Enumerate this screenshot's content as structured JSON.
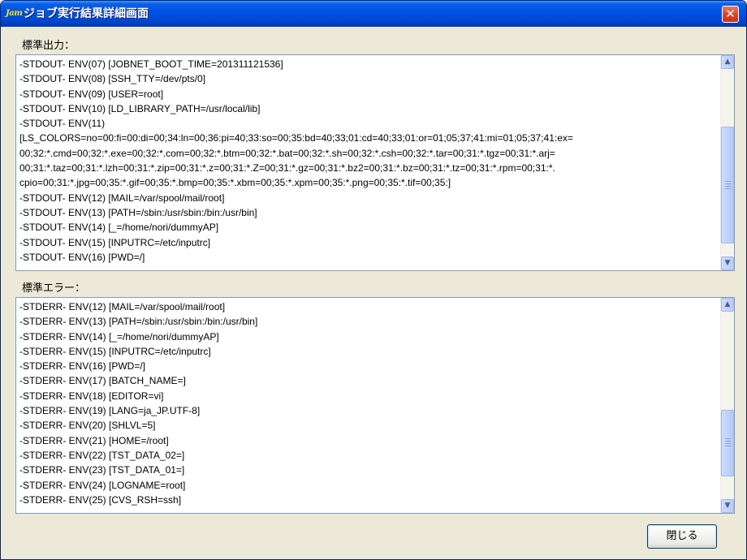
{
  "window": {
    "app_icon_text": "Jam",
    "title": "ジョブ実行結果詳細画面",
    "close_glyph": "✕"
  },
  "stdout": {
    "label": "標準出力：",
    "lines": [
      "-STDOUT- ENV(07) [JOBNET_BOOT_TIME=201311121536]",
      "-STDOUT- ENV(08) [SSH_TTY=/dev/pts/0]",
      "-STDOUT- ENV(09) [USER=root]",
      "-STDOUT- ENV(10) [LD_LIBRARY_PATH=/usr/local/lib]",
      "-STDOUT- ENV(11)",
      "[LS_COLORS=no=00:fi=00:di=00;34:ln=00;36:pi=40;33:so=00;35:bd=40;33;01:cd=40;33;01:or=01;05;37;41:mi=01;05;37;41:ex=",
      "00;32:*.cmd=00;32:*.exe=00;32:*.com=00;32:*.btm=00;32:*.bat=00;32:*.sh=00;32:*.csh=00;32:*.tar=00;31:*.tgz=00;31:*.arj=",
      "00;31:*.taz=00;31:*.lzh=00;31:*.zip=00;31:*.z=00;31:*.Z=00;31:*.gz=00;31:*.bz2=00;31:*.bz=00;31:*.tz=00;31:*.rpm=00;31:*.",
      "cpio=00;31:*.jpg=00;35:*.gif=00;35:*.bmp=00;35:*.xbm=00;35:*.xpm=00;35:*.png=00;35:*.tif=00;35:]",
      "-STDOUT- ENV(12) [MAIL=/var/spool/mail/root]",
      "-STDOUT- ENV(13) [PATH=/sbin:/usr/sbin:/bin:/usr/bin]",
      "-STDOUT- ENV(14) [_=/home/nori/dummyAP]",
      "-STDOUT- ENV(15) [INPUTRC=/etc/inputrc]",
      "-STDOUT- ENV(16) [PWD=/]"
    ]
  },
  "stderr": {
    "label": "標準エラー：",
    "lines": [
      "-STDERR- ENV(12) [MAIL=/var/spool/mail/root]",
      "-STDERR- ENV(13) [PATH=/sbin:/usr/sbin:/bin:/usr/bin]",
      "-STDERR- ENV(14) [_=/home/nori/dummyAP]",
      "-STDERR- ENV(15) [INPUTRC=/etc/inputrc]",
      "-STDERR- ENV(16) [PWD=/]",
      "-STDERR- ENV(17) [BATCH_NAME=]",
      "-STDERR- ENV(18) [EDITOR=vi]",
      "-STDERR- ENV(19) [LANG=ja_JP.UTF-8]",
      "-STDERR- ENV(20) [SHLVL=5]",
      "-STDERR- ENV(21) [HOME=/root]",
      "-STDERR- ENV(22) [TST_DATA_02=]",
      "-STDERR- ENV(23) [TST_DATA_01=]",
      "-STDERR- ENV(24) [LOGNAME=root]",
      "-STDERR- ENV(25) [CVS_RSH=ssh]"
    ]
  },
  "scroll_icons": {
    "up": "chevron-up-icon",
    "down": "chevron-down-icon",
    "up_glyph": "▲",
    "down_glyph": "▼"
  },
  "footer": {
    "close_label": "閉じる"
  },
  "colors": {
    "titlebar": "#0054e3",
    "dialog_bg": "#ece9d8",
    "textbox_border": "#7f9db9",
    "close_x": "#d6452a"
  }
}
